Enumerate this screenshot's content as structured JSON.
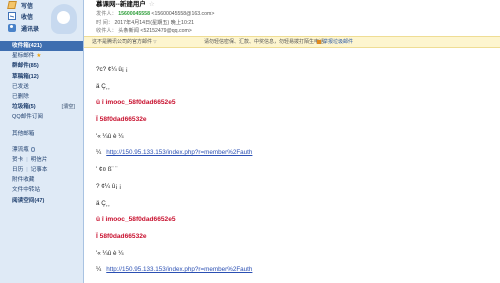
{
  "sidebar": {
    "actions": [
      {
        "label": "写信",
        "icon": "write-icon"
      },
      {
        "label": "收信",
        "icon": "inbox-icon"
      },
      {
        "label": "通讯录",
        "icon": "contacts-icon"
      }
    ],
    "folders": [
      {
        "label": "收件箱(421)"
      },
      {
        "label": "星标邮件"
      },
      {
        "label": "群邮件(85)"
      },
      {
        "label": "草稿箱(12)"
      },
      {
        "label": "已发送"
      },
      {
        "label": "已删除"
      },
      {
        "label": "垃圾箱(5)",
        "aux": "[清空]"
      },
      {
        "label": "QQ邮件订阅"
      },
      {
        "label": "其他邮箱"
      },
      {
        "label": "漂流瓶"
      },
      {
        "label": "贺卡",
        "label2": "明信片"
      },
      {
        "label": "日历",
        "label2": "记事本"
      },
      {
        "label": "附件收藏"
      },
      {
        "label": "文件中转站"
      },
      {
        "label": "阅读空间(47)"
      }
    ]
  },
  "email": {
    "subject": "慕课网--新建用户",
    "sender_label": "发件人：",
    "sender_name": "15600045558",
    "sender_email": "<15600045558@163.com>",
    "time_label": "时 间：",
    "time_value": "2017年4月14日(星期五) 晚上10:21",
    "recipient_label": "收件人：",
    "recipient_value": "头条新闻 <52152479@qq.com>"
  },
  "warning": {
    "text1": "这不是腾讯公司的官方邮件",
    "text2": "请勿轻信密保、汇款、中奖信息，勿轻易拨打陌生电话。",
    "report": "举报垃圾邮件"
  },
  "body": {
    "lines": [
      "?c? ¢¼ û¡ ¡",
      "ä Ç¸¸",
      "û î imooc_58f0dad6652e5",
      "Ï 58f0dad66532e",
      "'« ¼û è ¼",
      "http://150.95.133.153/index.php?r=member%2Fauth",
      "' ¢¤ ß¨ ¨",
      "? ¢¼ û¡ ¡",
      "ä Ç¸¸",
      "û î imooc_58f0dad6652e5",
      "Ï 58f0dad66532e",
      "'« ¼û è ¼",
      "http://150.95.133.153/index.php?r=member%2Fauth"
    ],
    "link_prefix": "¼"
  },
  "colors": {
    "sidebar_bg": "#dfeaf6",
    "selected_folder": "#3e6eb0",
    "sender_green": "#2e9e3a",
    "highlight_red": "#c8102e",
    "link_blue": "#2a4fb3",
    "warning_bg": "#fdf5cf"
  }
}
